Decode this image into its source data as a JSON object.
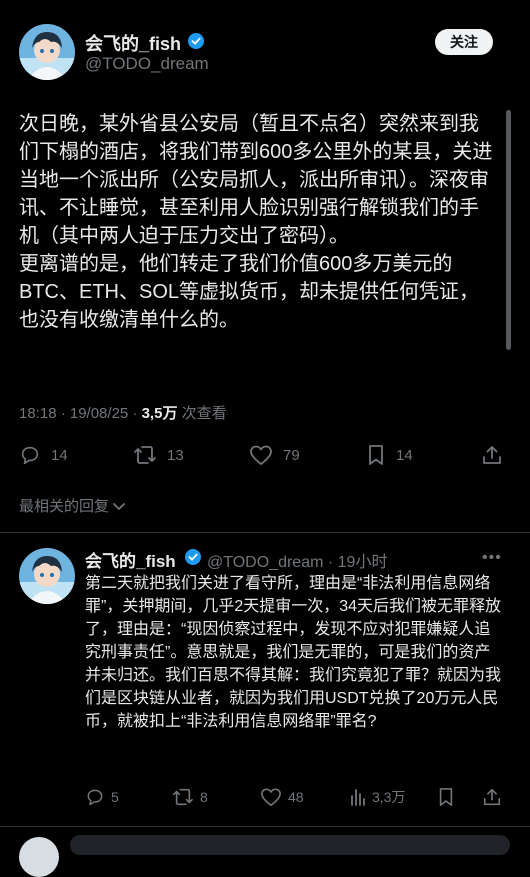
{
  "tweet": {
    "author_name": "会飞的_fish",
    "author_handle": "@TODO_dream",
    "follow_label": "关注",
    "paragraph1": "次日晚，某外省县公安局（暂且不点名）突然来到我们下榻的酒店，将我们带到600多公里外的某县，关进当地一个派出所（公安局抓人，派出所审讯）。深夜审讯、不让睡觉，甚至利用人脸识别强行解锁我们的手机（其中两人迫于压力交出了密码）。",
    "paragraph2": "更离谱的是，他们转走了我们价值600多万美元的BTC、ETH、SOL等虚拟货币，却未提供任何凭证，也没有收缴清单什么的。",
    "timestamp": "18:18 · 19/08/25 · ",
    "views_count": "3,5万",
    "views_label": " 次查看",
    "replies": "14",
    "retweets": "13",
    "likes": "79",
    "bookmarks": "14"
  },
  "replies_section": {
    "label": "最相关的回复",
    "chevron": "chevron-down-icon"
  },
  "reply": {
    "author_name": "会飞的_fish",
    "author_handle": "@TODO_dream",
    "separator": " · ",
    "time": "19小时",
    "text": "第二天就把我们关进了看守所，理由是“非法利用信息网络罪”，关押期间，几乎2天提审一次，34天后我们被无罪释放了，理由是：“现因侦察过程中，发现不应对犯罪嫌疑人追究刑事责任”。意思就是，我们是无罪的，可是我们的资产并未归还。我们百思不得其解：我们究竟犯了罪？就因为我们是区块链从业者，就因为我们用USDT兑换了20万元人民币，就被扣上“非法利用信息网络罪”罪名?",
    "replies": "5",
    "retweets": "8",
    "likes": "48",
    "views": "3,3万"
  },
  "colors": {
    "background": "#000000",
    "text": "#e7e9ea",
    "secondary": "#71767b",
    "verified": "#1d9bf0",
    "divider": "#2f3336"
  }
}
